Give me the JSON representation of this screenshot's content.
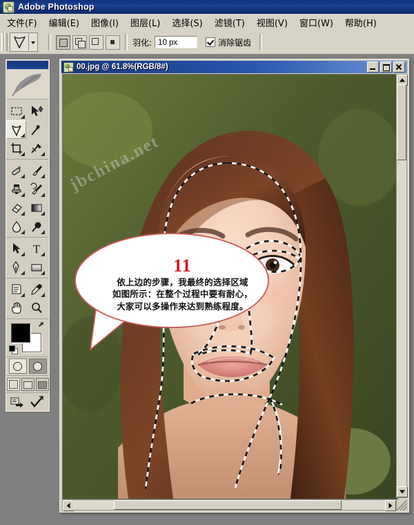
{
  "app": {
    "title": "Adobe Photoshop",
    "icon": "photoshop-icon"
  },
  "menubar": {
    "items": [
      {
        "label": "文件(F)",
        "name": "file"
      },
      {
        "label": "编辑(E)",
        "name": "edit"
      },
      {
        "label": "图像(I)",
        "name": "image"
      },
      {
        "label": "图层(L)",
        "name": "layer"
      },
      {
        "label": "选择(S)",
        "name": "select"
      },
      {
        "label": "滤镜(T)",
        "name": "filter"
      },
      {
        "label": "视图(V)",
        "name": "view"
      },
      {
        "label": "窗口(W)",
        "name": "window"
      },
      {
        "label": "帮助(H)",
        "name": "help"
      }
    ]
  },
  "options_bar": {
    "active_tool": "lasso-tool",
    "selection_modes": [
      "new-selection",
      "add-to-selection",
      "subtract-from-selection",
      "intersect-with-selection"
    ],
    "active_selection_mode": 0,
    "feather_label": "羽化:",
    "feather_value": "10 px",
    "antialias_label": "消除锯齿",
    "antialias_checked": true
  },
  "toolbox": {
    "tools": [
      {
        "name": "marquee-tool",
        "selected": false
      },
      {
        "name": "move-tool",
        "selected": false
      },
      {
        "name": "lasso-tool",
        "selected": true
      },
      {
        "name": "magic-wand-tool",
        "selected": false
      },
      {
        "name": "crop-tool",
        "selected": false
      },
      {
        "name": "slice-tool",
        "selected": false
      },
      {
        "name": "healing-brush-tool",
        "selected": false
      },
      {
        "name": "brush-tool",
        "selected": false
      },
      {
        "name": "clone-stamp-tool",
        "selected": false
      },
      {
        "name": "history-brush-tool",
        "selected": false
      },
      {
        "name": "eraser-tool",
        "selected": false
      },
      {
        "name": "gradient-tool",
        "selected": false
      },
      {
        "name": "blur-tool",
        "selected": false
      },
      {
        "name": "dodge-tool",
        "selected": false
      },
      {
        "name": "path-selection-tool",
        "selected": false
      },
      {
        "name": "type-tool",
        "selected": false
      },
      {
        "name": "pen-tool",
        "selected": false
      },
      {
        "name": "shape-tool",
        "selected": false
      },
      {
        "name": "notes-tool",
        "selected": false
      },
      {
        "name": "eyedropper-tool",
        "selected": false
      },
      {
        "name": "hand-tool",
        "selected": false
      },
      {
        "name": "zoom-tool",
        "selected": false
      }
    ],
    "foreground_color": "#000000",
    "background_color": "#ffffff",
    "mask_modes": [
      "standard-mask-mode",
      "quick-mask-mode"
    ],
    "screen_modes": [
      "standard-screen-mode",
      "full-screen-with-menubar",
      "full-screen-mode"
    ],
    "jump_to": "jump-to-imageready"
  },
  "document": {
    "title": "00.jpg @ 61.8%(RGB/8#)",
    "filename": "00.jpg",
    "zoom": "61.8%",
    "mode": "RGB/8#",
    "window_buttons": [
      "minimize",
      "maximize",
      "close"
    ],
    "watermark": "jbchina.net"
  },
  "callout": {
    "number": "11",
    "lines": [
      "依上边的步骤，我最终的选择区域",
      "如图所示：在整个过程中要有耐心，",
      "大家可以多操作来达到熟练程度。"
    ],
    "number_color": "#d8151a",
    "bubble_fill": "#ffffff"
  },
  "colors": {
    "titlebar": "#163a8a",
    "chrome": "#d6d3c6",
    "desktop": "#808080",
    "accent": "#d8151a"
  }
}
